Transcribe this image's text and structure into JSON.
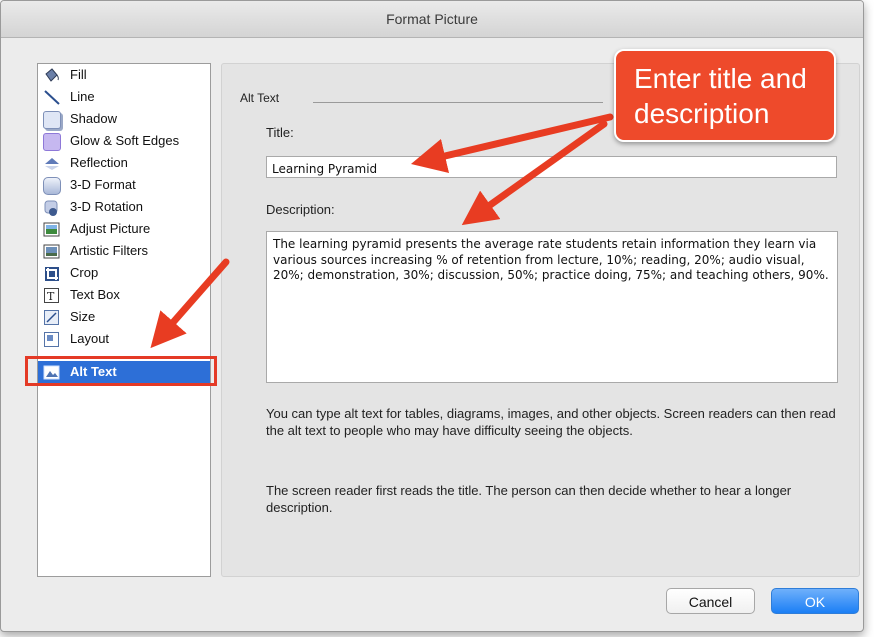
{
  "window": {
    "title": "Format Picture"
  },
  "sidebar": {
    "items": [
      {
        "label": "Fill",
        "icon": "fill-bucket-icon"
      },
      {
        "label": "Line",
        "icon": "line-icon"
      },
      {
        "label": "Shadow",
        "icon": "shadow-icon"
      },
      {
        "label": "Glow & Soft Edges",
        "icon": "glow-icon"
      },
      {
        "label": "Reflection",
        "icon": "reflection-icon"
      },
      {
        "label": "3-D Format",
        "icon": "3d-format-icon"
      },
      {
        "label": "3-D Rotation",
        "icon": "3d-rotation-icon"
      },
      {
        "label": "Adjust Picture",
        "icon": "adjust-picture-icon"
      },
      {
        "label": "Artistic Filters",
        "icon": "artistic-filters-icon"
      },
      {
        "label": "Crop",
        "icon": "crop-icon"
      },
      {
        "label": "Text Box",
        "icon": "text-box-icon"
      },
      {
        "label": "Size",
        "icon": "size-icon"
      },
      {
        "label": "Layout",
        "icon": "layout-icon"
      },
      {
        "label": "Alt Text",
        "icon": "alt-text-icon",
        "selected": true
      }
    ]
  },
  "alt_text": {
    "section_label": "Alt Text",
    "title_label": "Title:",
    "title_value": "Learning Pyramid",
    "description_label": "Description:",
    "description_value": "The learning pyramid presents the average rate students retain information they learn via various sources increasing % of retention from lecture, 10%; reading, 20%; audio visual, 20%; demonstration, 30%; discussion, 50%; practice doing, 75%; and teaching others, 90%.",
    "help_text_1": "You can type alt text for tables, diagrams, images, and other objects. Screen readers can then read the alt text to people who may have difficulty seeing the objects.",
    "help_text_2": "The screen reader first reads the title. The person can then decide whether to hear a longer description."
  },
  "buttons": {
    "cancel": "Cancel",
    "ok": "OK"
  },
  "annotation": {
    "callout_line_1": "Enter title and",
    "callout_line_2": "description"
  },
  "colors": {
    "accent": "#2d6fd7",
    "annotation": "#ee4a2b",
    "ok_button": "#1b7ff5"
  }
}
